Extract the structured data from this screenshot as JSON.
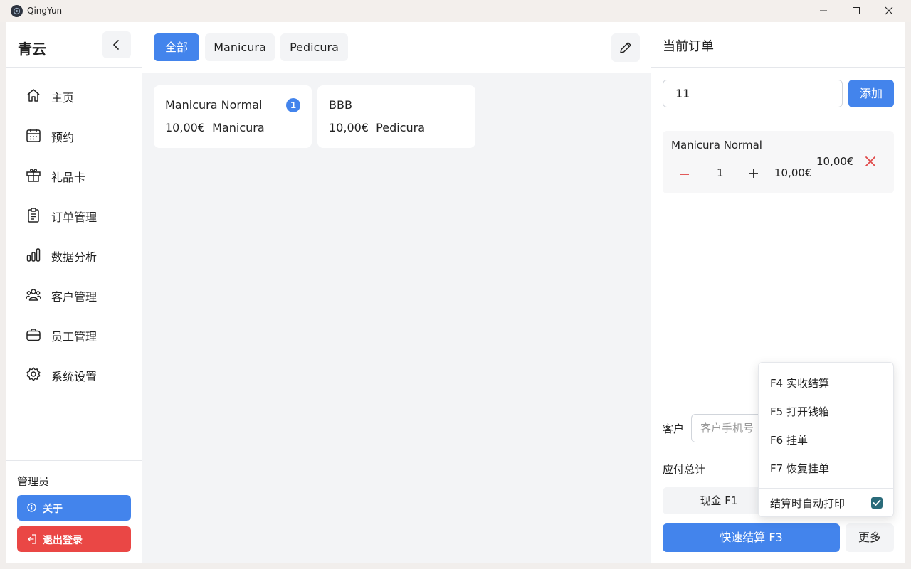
{
  "window": {
    "title": "QingYun",
    "controls": [
      "minimize-icon",
      "maximize-icon",
      "close-icon"
    ]
  },
  "sidebar": {
    "brand": "青云",
    "items": [
      {
        "label": "主页",
        "icon": "home-icon"
      },
      {
        "label": "预约",
        "icon": "calendar-icon"
      },
      {
        "label": "礼品卡",
        "icon": "gift-icon"
      },
      {
        "label": "订单管理",
        "icon": "clipboard-icon"
      },
      {
        "label": "数据分析",
        "icon": "bar-chart-icon"
      },
      {
        "label": "客户管理",
        "icon": "users-icon"
      },
      {
        "label": "员工管理",
        "icon": "briefcase-icon"
      },
      {
        "label": "系统设置",
        "icon": "gear-icon"
      }
    ],
    "role": "管理员",
    "about_label": "关于",
    "logout_label": "退出登录"
  },
  "catalog": {
    "tabs": [
      {
        "label": "全部",
        "active": true
      },
      {
        "label": "Manicura",
        "active": false
      },
      {
        "label": "Pedicura",
        "active": false
      }
    ],
    "products": [
      {
        "name": "Manicura Normal",
        "price": "10,00€",
        "category": "Manicura",
        "in_cart": "1"
      },
      {
        "name": "BBB",
        "price": "10,00€",
        "category": "Pedicura",
        "in_cart": ""
      }
    ]
  },
  "order": {
    "title": "当前订单",
    "code_value": "11",
    "add_label": "添加",
    "items": [
      {
        "name": "Manicura Normal",
        "qty": "1",
        "unit_price": "10,00€",
        "total": "10,00€"
      }
    ],
    "customer_label": "客户",
    "customer_placeholder": "客户手机号",
    "due_label": "应付总计",
    "cash_label": "现金 F1",
    "checkout_label": "快速结算 F3",
    "more_label": "更多"
  },
  "more_menu": {
    "items": [
      "F4 实收结算",
      "F5 打开钱箱",
      "F6 挂单",
      "F7 恢复挂单"
    ],
    "auto_print_label": "结算时自动打印",
    "auto_print_checked": true
  },
  "colors": {
    "primary": "#4384ec",
    "danger": "#ea4745",
    "checkbox": "#2a6b7a"
  }
}
